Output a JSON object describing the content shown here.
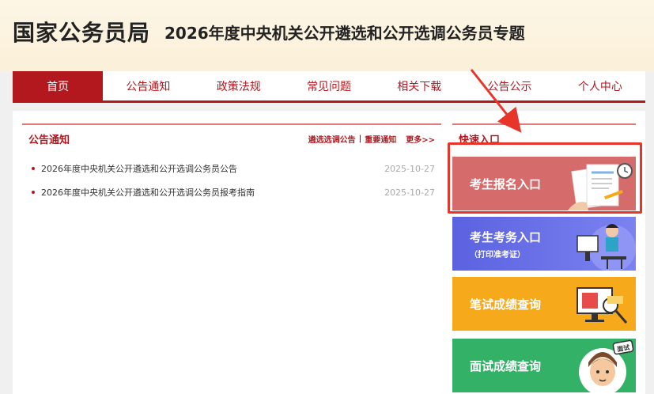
{
  "header": {
    "site_title": "国家公务员局",
    "topic_title": "2026年度中央机关公开遴选和公开选调公务员专题"
  },
  "nav": [
    {
      "label": "首页",
      "active": true
    },
    {
      "label": "公告通知",
      "active": false
    },
    {
      "label": "政策法规",
      "active": false
    },
    {
      "label": "常见问题",
      "active": false
    },
    {
      "label": "相关下载",
      "active": false
    },
    {
      "label": "公告公示",
      "active": false
    },
    {
      "label": "个人中心",
      "active": false
    }
  ],
  "notice": {
    "title": "公告通知",
    "link1": "遴选选调公告",
    "link2": "重要通知",
    "more": "更多>>",
    "items": [
      {
        "text": "2026年度中央机关公开遴选和公开选调公务员公告",
        "date": "2025-10-27"
      },
      {
        "text": "2026年度中央机关公开遴选和公开选调公务员报考指南",
        "date": "2025-10-27"
      }
    ]
  },
  "quick": {
    "title": "快速入口",
    "register": "考生报名入口",
    "exam": "考生考务入口",
    "exam_sub": "（打印准考证）",
    "written": "笔试成绩查询",
    "interview": "面试成绩查询",
    "interview_badge": "面试"
  },
  "colors": {
    "brand_red": "#b3181f",
    "card_red": "#d66b6b",
    "card_blue": "#5b62e0",
    "card_orange": "#f6a91a",
    "card_green": "#32b167",
    "annotation_red": "#e8352a"
  }
}
